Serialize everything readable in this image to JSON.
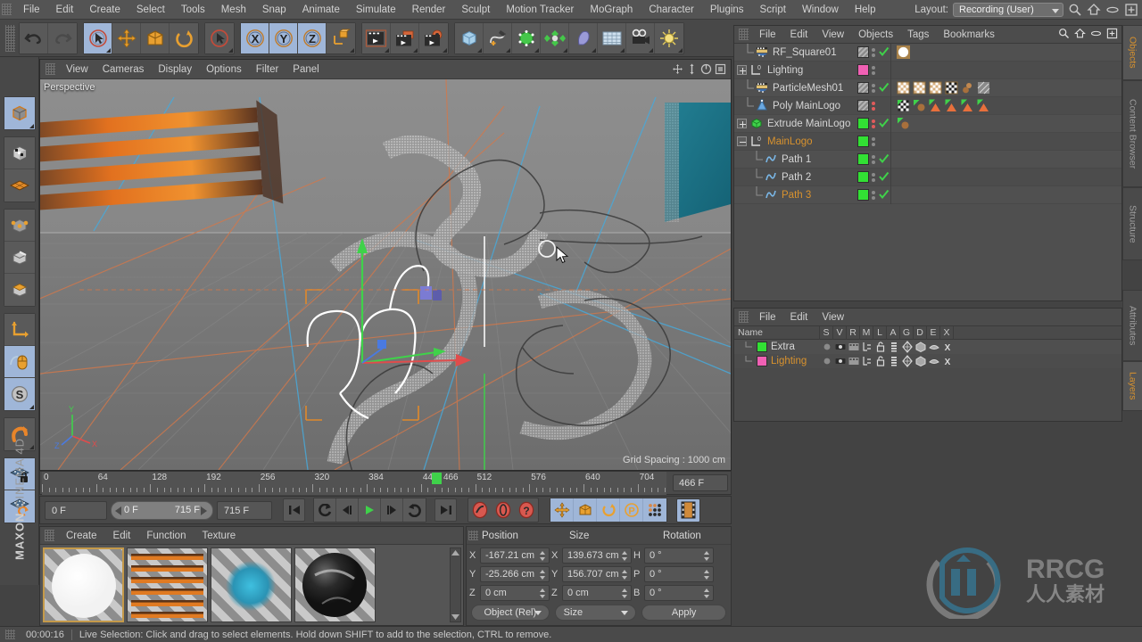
{
  "menubar": {
    "items": [
      "File",
      "Edit",
      "Create",
      "Select",
      "Tools",
      "Mesh",
      "Snap",
      "Animate",
      "Simulate",
      "Render",
      "Sculpt",
      "Motion Tracker",
      "MoGraph",
      "Character",
      "Plugins",
      "Script",
      "Window",
      "Help"
    ],
    "layout_label": "Layout:",
    "layout_value": "Recording (User)"
  },
  "toolbar": {
    "groups": [
      {
        "name": "history",
        "buttons": [
          {
            "name": "undo-button",
            "icon": "undo"
          },
          {
            "name": "redo-button",
            "icon": "redo"
          }
        ]
      },
      {
        "name": "tools",
        "buttons": [
          {
            "name": "live-selection-button",
            "icon": "cursor-circle",
            "selected": true
          },
          {
            "name": "move-tool-button",
            "icon": "move"
          },
          {
            "name": "scale-tool-button",
            "icon": "scale"
          },
          {
            "name": "rotate-tool-button",
            "icon": "rotate"
          }
        ]
      },
      {
        "name": "selection",
        "buttons": [
          {
            "name": "selection-mode-button",
            "icon": "cursor-circle-red"
          }
        ]
      },
      {
        "name": "axis-lock",
        "buttons": [
          {
            "name": "lock-x-button",
            "icon": "X",
            "selected": true
          },
          {
            "name": "lock-y-button",
            "icon": "Y",
            "selected": true
          },
          {
            "name": "lock-z-button",
            "icon": "Z",
            "selected": true
          },
          {
            "name": "world-coord-button",
            "icon": "world-cube"
          }
        ]
      },
      {
        "name": "render",
        "buttons": [
          {
            "name": "render-view-button",
            "icon": "clapper"
          },
          {
            "name": "render-region-button",
            "icon": "clapper-frame"
          },
          {
            "name": "render-settings-button",
            "icon": "clapper-gear"
          }
        ]
      },
      {
        "name": "create",
        "buttons": [
          {
            "name": "add-cube-button",
            "icon": "cube-blue"
          },
          {
            "name": "add-spline-button",
            "icon": "pen-spline"
          },
          {
            "name": "add-nurbs-button",
            "icon": "cube-green"
          },
          {
            "name": "add-array-button",
            "icon": "array-green"
          },
          {
            "name": "add-deformer-button",
            "icon": "bend-purple"
          },
          {
            "name": "add-floor-button",
            "icon": "floor-grid"
          },
          {
            "name": "add-camera-button",
            "icon": "camera"
          },
          {
            "name": "add-light-button",
            "icon": "light"
          }
        ]
      }
    ]
  },
  "left_toolbar": {
    "groups": [
      [
        {
          "name": "model-mode-button",
          "icon": "cube-orange",
          "selected": true
        }
      ],
      [
        {
          "name": "texture-mode-button",
          "icon": "cube-checker"
        },
        {
          "name": "workplane-button",
          "icon": "plane-orange"
        }
      ],
      [
        {
          "name": "point-mode-button",
          "icon": "points-cube"
        },
        {
          "name": "edge-mode-button",
          "icon": "edge-cube"
        },
        {
          "name": "polygon-mode-button",
          "icon": "poly-cube"
        }
      ],
      [
        {
          "name": "object-axis-button",
          "icon": "axis-orange"
        },
        {
          "name": "viewport-solo-button",
          "icon": "mouse-orange",
          "selected": true
        },
        {
          "name": "enable-snap-button",
          "icon": "s-circle",
          "selected": true
        }
      ],
      [
        {
          "name": "magnet-tool-button",
          "icon": "magnet"
        }
      ],
      [
        {
          "name": "lock-workplane-button",
          "icon": "grid-lock",
          "selected": true
        },
        {
          "name": "planar-workplane-button",
          "icon": "grid-rotate",
          "selected": true
        }
      ]
    ],
    "brand_top": "MAXON",
    "brand_bottom": "CINEMA 4D"
  },
  "viewport": {
    "menus": [
      "View",
      "Cameras",
      "Display",
      "Options",
      "Filter",
      "Panel"
    ],
    "perspective_label": "Perspective",
    "grid_spacing": "Grid Spacing : 1000 cm",
    "icons": [
      "move-view-icon",
      "pan-view-icon",
      "rotate-view-icon",
      "maximize-view-icon"
    ]
  },
  "timeline": {
    "tick_labels": [
      "0",
      "64",
      "128",
      "192",
      "256",
      "320",
      "384",
      "448",
      "512",
      "576",
      "640",
      "704"
    ],
    "tick_values": [
      0,
      64,
      128,
      192,
      256,
      320,
      384,
      448,
      512,
      576,
      640,
      704
    ],
    "current_frame_marker": 466,
    "current_frame_marker_label": "466",
    "frame_field": "466 F",
    "range_start": "0 F",
    "range_min": "0 F",
    "range_max": "715 F",
    "range_end": "715 F"
  },
  "transport": {
    "buttons": [
      {
        "name": "go-to-start-button",
        "icon": "skip-start"
      },
      {
        "name": "previous-key-button",
        "icon": "prev-key"
      },
      {
        "name": "step-back-button",
        "icon": "step-back"
      },
      {
        "name": "play-button",
        "icon": "play"
      },
      {
        "name": "step-forward-button",
        "icon": "step-forward"
      },
      {
        "name": "next-key-button",
        "icon": "next-key"
      },
      {
        "name": "go-to-end-button",
        "icon": "skip-end"
      },
      {
        "name": "record-keyframe-button",
        "icon": "record-red"
      },
      {
        "name": "autokey-button",
        "icon": "autokey-red"
      },
      {
        "name": "keyframe-selection-button",
        "icon": "question-red"
      },
      {
        "name": "record-position-button",
        "icon": "position-cross"
      },
      {
        "name": "record-scale-button",
        "icon": "scale-orange"
      },
      {
        "name": "record-rotation-button",
        "icon": "rotate-orange"
      },
      {
        "name": "record-param-button",
        "icon": "p-circle"
      },
      {
        "name": "point-level-anim-button",
        "icon": "dots-grid"
      },
      {
        "name": "timeline-button",
        "icon": "filmstrip"
      }
    ]
  },
  "material_manager": {
    "menus": [
      "Create",
      "Edit",
      "Function",
      "Texture"
    ],
    "materials": [
      {
        "name": "material-white",
        "selected": true,
        "type": "white-sphere"
      },
      {
        "name": "material-orange-stripes",
        "selected": false,
        "type": "orange-stripe"
      },
      {
        "name": "material-blue",
        "selected": false,
        "type": "blue-square"
      },
      {
        "name": "material-dark-chrome",
        "selected": false,
        "type": "dark-sphere"
      }
    ]
  },
  "coordinates": {
    "headers": [
      "Position",
      "Size",
      "Rotation"
    ],
    "rows": [
      {
        "pos_label": "X",
        "pos_value": "-167.21 cm",
        "size_label": "X",
        "size_value": "139.673 cm",
        "rot_label": "H",
        "rot_value": "0 °"
      },
      {
        "pos_label": "Y",
        "pos_value": "-25.266 cm",
        "size_label": "Y",
        "size_value": "156.707 cm",
        "rot_label": "P",
        "rot_value": "0 °"
      },
      {
        "pos_label": "Z",
        "pos_value": "0 cm",
        "size_label": "Z",
        "size_value": "0 cm",
        "rot_label": "B",
        "rot_value": "0 °"
      }
    ],
    "mode_dropdown": "Object (Rel)",
    "size_dropdown": "Size",
    "apply_button": "Apply"
  },
  "object_manager": {
    "menus": [
      "File",
      "Edit",
      "View",
      "Objects",
      "Tags",
      "Bookmarks"
    ],
    "header_icons": [
      "search-icon",
      "home-icon",
      "eye-icon",
      "add-icon"
    ],
    "objects": [
      {
        "name": "RF_Square01",
        "depth": 1,
        "icon": "emitter",
        "expander": "none",
        "color": "#8a8a8a",
        "striped": true,
        "dots": "grey",
        "check": true,
        "highlight": false,
        "tags": [
          {
            "type": "white-sphere-selected"
          }
        ]
      },
      {
        "name": "Lighting",
        "depth": 0,
        "icon": "layer-zero",
        "expander": "plus",
        "color": "#f060b4",
        "striped": false,
        "dots": "grey",
        "check": false,
        "highlight": false,
        "tags": []
      },
      {
        "name": "ParticleMesh01",
        "depth": 1,
        "icon": "emitter",
        "expander": "none",
        "color": "#8a8a8a",
        "striped": true,
        "dots": "grey",
        "check": true,
        "highlight": false,
        "tags": [
          {
            "type": "checker"
          },
          {
            "type": "checker"
          },
          {
            "type": "checker"
          },
          {
            "type": "checker-bw"
          },
          {
            "type": "spheres"
          },
          {
            "type": "hatch"
          }
        ]
      },
      {
        "name": "Poly MainLogo",
        "depth": 1,
        "icon": "cone-blue",
        "expander": "none",
        "color": "#8a8a8a",
        "striped": true,
        "dots": "red",
        "check": false,
        "highlight": false,
        "tags": [
          {
            "type": "checker-bw-green"
          },
          {
            "type": "spheres-green"
          },
          {
            "type": "triangle"
          },
          {
            "type": "triangle"
          },
          {
            "type": "triangle"
          },
          {
            "type": "triangle"
          }
        ]
      },
      {
        "name": "Extrude MainLogo",
        "depth": 0,
        "icon": "extrude-green",
        "expander": "plus",
        "color": "#32e034",
        "striped": false,
        "dots": "red",
        "check": true,
        "highlight": false,
        "tags": [
          {
            "type": "spheres-green"
          }
        ]
      },
      {
        "name": "MainLogo",
        "depth": 0,
        "icon": "layer-zero",
        "expander": "minus",
        "color": "#32e034",
        "striped": false,
        "dots": "grey",
        "check": false,
        "highlight": true,
        "tags": []
      },
      {
        "name": "Path 1",
        "depth": 2,
        "icon": "spline",
        "expander": "none",
        "color": "#32e034",
        "striped": false,
        "dots": "grey",
        "check": true,
        "highlight": false,
        "tags": []
      },
      {
        "name": "Path 2",
        "depth": 2,
        "icon": "spline",
        "expander": "none",
        "color": "#32e034",
        "striped": false,
        "dots": "grey",
        "check": true,
        "highlight": false,
        "tags": []
      },
      {
        "name": "Path 3",
        "depth": 2,
        "icon": "spline",
        "expander": "none",
        "color": "#32e034",
        "striped": false,
        "dots": "grey",
        "check": true,
        "highlight": true,
        "tags": []
      }
    ]
  },
  "layer_manager": {
    "menus": [
      "File",
      "Edit",
      "View"
    ],
    "columns": [
      "Name",
      "S",
      "V",
      "R",
      "M",
      "L",
      "A",
      "G",
      "D",
      "E",
      "X"
    ],
    "rows": [
      {
        "name": "Extra",
        "color": "#32e034",
        "highlight": false
      },
      {
        "name": "Lighting",
        "color": "#f060b4",
        "highlight": true
      }
    ]
  },
  "right_tabs": {
    "top": [
      {
        "label": "Objects",
        "active": true
      },
      {
        "label": "Content Browser",
        "active": false
      },
      {
        "label": "Structure",
        "active": false
      }
    ],
    "bottom": [
      {
        "label": "Attributes",
        "active": false
      },
      {
        "label": "Layers",
        "active": true
      }
    ]
  },
  "status_bar": {
    "time": "00:00:16",
    "message": "Live Selection: Click and drag to select elements. Hold down SHIFT to add to the selection, CTRL to remove."
  },
  "watermark": {
    "text": "RRCG",
    "subtext": "人人素材"
  },
  "colors": {
    "accent_orange": "#d8922e",
    "green": "#32e034",
    "pink": "#f060b4",
    "selected_blue": "#9fb6d8",
    "panel_bg": "#4a4a4a"
  }
}
